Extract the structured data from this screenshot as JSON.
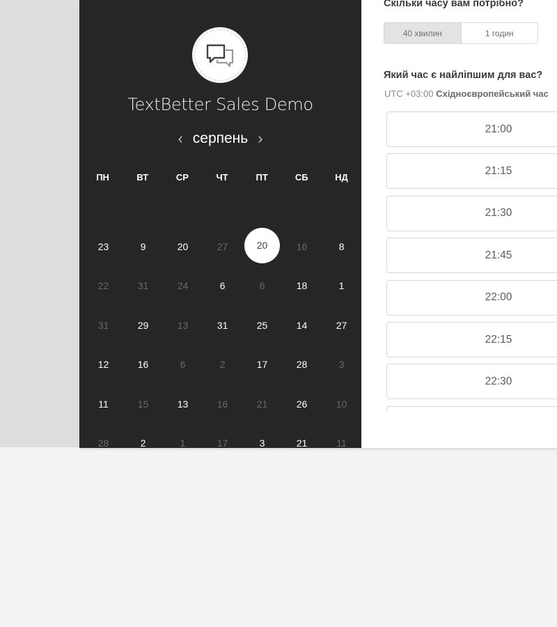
{
  "calendar": {
    "title": "TextBetter Sales Demo",
    "month": "серпень",
    "prev_arrow": "‹",
    "next_arrow": "›",
    "weekdays": [
      "ПН",
      "ВТ",
      "СР",
      "ЧТ",
      "ПТ",
      "СБ",
      "НД"
    ],
    "days": [
      {
        "label": "23",
        "available": true
      },
      {
        "label": "9",
        "available": true
      },
      {
        "label": "20",
        "available": true
      },
      {
        "label": "27",
        "available": false
      },
      {
        "label": "20",
        "available": true,
        "selected": true
      },
      {
        "label": "16",
        "available": false
      },
      {
        "label": "8",
        "available": true
      },
      {
        "label": "22",
        "available": false
      },
      {
        "label": "31",
        "available": false
      },
      {
        "label": "24",
        "available": false
      },
      {
        "label": "6",
        "available": true
      },
      {
        "label": "6",
        "available": false
      },
      {
        "label": "18",
        "available": true
      },
      {
        "label": "1",
        "available": true
      },
      {
        "label": "31",
        "available": false
      },
      {
        "label": "29",
        "available": true
      },
      {
        "label": "13",
        "available": false
      },
      {
        "label": "31",
        "available": true
      },
      {
        "label": "25",
        "available": true
      },
      {
        "label": "14",
        "available": true
      },
      {
        "label": "27",
        "available": true
      },
      {
        "label": "12",
        "available": true
      },
      {
        "label": "16",
        "available": true
      },
      {
        "label": "6",
        "available": false
      },
      {
        "label": "2",
        "available": false
      },
      {
        "label": "17",
        "available": true
      },
      {
        "label": "28",
        "available": true
      },
      {
        "label": "3",
        "available": false
      },
      {
        "label": "11",
        "available": true
      },
      {
        "label": "15",
        "available": false
      },
      {
        "label": "13",
        "available": true
      },
      {
        "label": "16",
        "available": false
      },
      {
        "label": "21",
        "available": false
      },
      {
        "label": "26",
        "available": true
      },
      {
        "label": "10",
        "available": false
      },
      {
        "label": "28",
        "available": false
      },
      {
        "label": "2",
        "available": true
      },
      {
        "label": "1",
        "available": false
      },
      {
        "label": "17",
        "available": false
      },
      {
        "label": "3",
        "available": true
      },
      {
        "label": "21",
        "available": true
      },
      {
        "label": "11",
        "available": false
      }
    ]
  },
  "booking": {
    "duration_question": "Скільки часу вам потрібно?",
    "durations": [
      {
        "label": "40 хвилин",
        "active": true
      },
      {
        "label": "1 годин",
        "active": false
      }
    ],
    "time_question": "Який час є найліпшим для вас?",
    "timezone_offset": "UTC +03:00",
    "timezone_name": "Східноєвропейський час",
    "slots": [
      "21:00",
      "21:15",
      "21:30",
      "21:45",
      "22:00",
      "22:15",
      "22:30",
      ""
    ]
  },
  "icons": {
    "logo": "chat-bubbles-icon"
  }
}
